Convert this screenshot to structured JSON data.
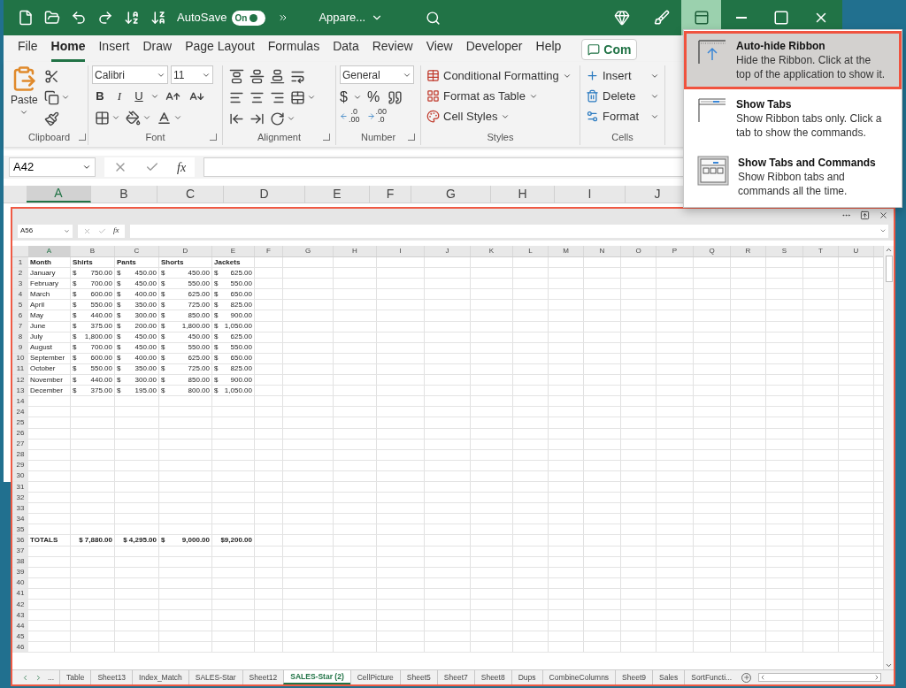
{
  "window": {
    "title": "Appare...",
    "autosave": {
      "label": "AutoSave",
      "toggle": "On",
      "on": true
    }
  },
  "caption_buttons": [
    {
      "kind": "premium",
      "selected": false
    },
    {
      "kind": "draw",
      "selected": false
    },
    {
      "kind": "ribbon-options",
      "selected": true
    },
    {
      "kind": "minimize",
      "selected": false
    },
    {
      "kind": "maximize",
      "selected": false
    },
    {
      "kind": "close",
      "selected": false
    }
  ],
  "ribbon_tabs": [
    {
      "label": "File",
      "selected": false
    },
    {
      "label": "Home",
      "selected": true
    },
    {
      "label": "Insert",
      "selected": false
    },
    {
      "label": "Draw",
      "selected": false
    },
    {
      "label": "Page Layout",
      "selected": false
    },
    {
      "label": "Formulas",
      "selected": false
    },
    {
      "label": "Data",
      "selected": false
    },
    {
      "label": "Review",
      "selected": false
    },
    {
      "label": "View",
      "selected": false
    },
    {
      "label": "Developer",
      "selected": false
    },
    {
      "label": "Help",
      "selected": false
    }
  ],
  "comments_button": {
    "label": "Com"
  },
  "ribbon": {
    "clipboard": {
      "paste": "Paste",
      "label": "Clipboard"
    },
    "font": {
      "name": "Calibri",
      "size": "11",
      "bold": "B",
      "italic": "I",
      "underline": "U",
      "label": "Font"
    },
    "alignment": {
      "label": "Alignment"
    },
    "number": {
      "format": "General",
      "currency": "$",
      "percent": "%",
      "decimal_increase": [
        ".0",
        ".00"
      ],
      "decimal_decrease": [
        ".00",
        ".0"
      ],
      "label": "Number"
    },
    "styles": {
      "items": [
        "Conditional Formatting",
        "Format as Table",
        "Cell Styles"
      ],
      "label": "Styles"
    },
    "cells": {
      "items": [
        "Insert",
        "Delete",
        "Format"
      ],
      "label": "Cells"
    }
  },
  "formula_bar": {
    "name_box": "A42",
    "fx": "fx"
  },
  "columns": [
    {
      "label": "A",
      "selected": true
    },
    {
      "label": "B",
      "selected": false
    },
    {
      "label": "C",
      "selected": false
    },
    {
      "label": "D",
      "selected": false
    },
    {
      "label": "E",
      "selected": false
    },
    {
      "label": "F",
      "selected": false
    },
    {
      "label": "G",
      "selected": false
    },
    {
      "label": "H",
      "selected": false
    },
    {
      "label": "I",
      "selected": false
    },
    {
      "label": "J",
      "selected": false
    }
  ],
  "inset": {
    "name_box": "A56",
    "fx": "fx",
    "columns": [
      {
        "label": "A",
        "selected": true
      },
      {
        "label": "B",
        "selected": false
      },
      {
        "label": "C",
        "selected": false
      },
      {
        "label": "D",
        "selected": false
      },
      {
        "label": "E",
        "selected": false
      },
      {
        "label": "F",
        "selected": false
      },
      {
        "label": "G",
        "selected": false
      },
      {
        "label": "H",
        "selected": false
      },
      {
        "label": "I",
        "selected": false
      },
      {
        "label": "J",
        "selected": false
      },
      {
        "label": "K",
        "selected": false
      },
      {
        "label": "L",
        "selected": false
      },
      {
        "label": "M",
        "selected": false
      },
      {
        "label": "N",
        "selected": false
      },
      {
        "label": "O",
        "selected": false
      },
      {
        "label": "P",
        "selected": false
      },
      {
        "label": "Q",
        "selected": false
      },
      {
        "label": "R",
        "selected": false
      },
      {
        "label": "S",
        "selected": false
      },
      {
        "label": "T",
        "selected": false
      },
      {
        "label": "U",
        "selected": false
      }
    ],
    "rows": [
      {
        "header": "1",
        "bold": true,
        "cells": [
          "Month",
          "Shirts",
          "Pants",
          "Shorts",
          "Jackets"
        ]
      },
      {
        "header": "2",
        "bold": false,
        "cells": [
          "January",
          [
            "$",
            "750.00"
          ],
          [
            "$",
            "450.00"
          ],
          [
            "$",
            "450.00"
          ],
          [
            "$",
            "625.00"
          ]
        ]
      },
      {
        "header": "3",
        "bold": false,
        "cells": [
          "February",
          [
            "$",
            "700.00"
          ],
          [
            "$",
            "450.00"
          ],
          [
            "$",
            "550.00"
          ],
          [
            "$",
            "550.00"
          ]
        ]
      },
      {
        "header": "4",
        "bold": false,
        "cells": [
          "March",
          [
            "$",
            "600.00"
          ],
          [
            "$",
            "400.00"
          ],
          [
            "$",
            "625.00"
          ],
          [
            "$",
            "650.00"
          ]
        ]
      },
      {
        "header": "5",
        "bold": false,
        "cells": [
          "April",
          [
            "$",
            "550.00"
          ],
          [
            "$",
            "350.00"
          ],
          [
            "$",
            "725.00"
          ],
          [
            "$",
            "825.00"
          ]
        ]
      },
      {
        "header": "6",
        "bold": false,
        "cells": [
          "May",
          [
            "$",
            "440.00"
          ],
          [
            "$",
            "300.00"
          ],
          [
            "$",
            "850.00"
          ],
          [
            "$",
            "900.00"
          ]
        ]
      },
      {
        "header": "7",
        "bold": false,
        "cells": [
          "June",
          [
            "$",
            "375.00"
          ],
          [
            "$",
            "200.00"
          ],
          [
            "$",
            "1,800.00"
          ],
          [
            "$",
            "1,050.00"
          ]
        ]
      },
      {
        "header": "8",
        "bold": false,
        "cells": [
          "July",
          [
            "$",
            "1,800.00"
          ],
          [
            "$",
            "450.00"
          ],
          [
            "$",
            "450.00"
          ],
          [
            "$",
            "625.00"
          ]
        ]
      },
      {
        "header": "9",
        "bold": false,
        "cells": [
          "August",
          [
            "$",
            "700.00"
          ],
          [
            "$",
            "450.00"
          ],
          [
            "$",
            "550.00"
          ],
          [
            "$",
            "550.00"
          ]
        ]
      },
      {
        "header": "10",
        "bold": false,
        "cells": [
          "September",
          [
            "$",
            "600.00"
          ],
          [
            "$",
            "400.00"
          ],
          [
            "$",
            "625.00"
          ],
          [
            "$",
            "650.00"
          ]
        ]
      },
      {
        "header": "11",
        "bold": false,
        "cells": [
          "October",
          [
            "$",
            "550.00"
          ],
          [
            "$",
            "350.00"
          ],
          [
            "$",
            "725.00"
          ],
          [
            "$",
            "825.00"
          ]
        ]
      },
      {
        "header": "12",
        "bold": false,
        "cells": [
          "November",
          [
            "$",
            "440.00"
          ],
          [
            "$",
            "300.00"
          ],
          [
            "$",
            "850.00"
          ],
          [
            "$",
            "900.00"
          ]
        ]
      },
      {
        "header": "13",
        "bold": false,
        "cells": [
          "December",
          [
            "$",
            "375.00"
          ],
          [
            "$",
            "195.00"
          ],
          [
            "$",
            "800.00"
          ],
          [
            "$",
            "1,050.00"
          ]
        ]
      },
      {
        "header": "14"
      },
      {
        "header": "24"
      },
      {
        "header": "25"
      },
      {
        "header": "26"
      },
      {
        "header": "27"
      },
      {
        "header": "28"
      },
      {
        "header": "29"
      },
      {
        "header": "30"
      },
      {
        "header": "31"
      },
      {
        "header": "32"
      },
      {
        "header": "33"
      },
      {
        "header": "34"
      },
      {
        "header": "35"
      },
      {
        "header": "36",
        "bold": true,
        "cells": [
          "TOTALS",
          [
            "$ 7,880.00"
          ],
          [
            "$ 4,295.00"
          ],
          [
            "$",
            "9,000.00"
          ],
          [
            "$9,200.00"
          ]
        ]
      },
      {
        "header": "37"
      },
      {
        "header": "38"
      },
      {
        "header": "39"
      },
      {
        "header": "40"
      },
      {
        "header": "41"
      },
      {
        "header": "42"
      },
      {
        "header": "43"
      },
      {
        "header": "44"
      },
      {
        "header": "45"
      },
      {
        "header": "46"
      }
    ],
    "more_tabs": "...",
    "sheet_tabs": [
      {
        "label": "Table",
        "selected": false
      },
      {
        "label": "Sheet13",
        "selected": false
      },
      {
        "label": "Index_Match",
        "selected": false
      },
      {
        "label": "SALES-Star",
        "selected": false
      },
      {
        "label": "Sheet12",
        "selected": false
      },
      {
        "label": "SALES-Star (2)",
        "selected": true
      },
      {
        "label": "CellPicture",
        "selected": false
      },
      {
        "label": "Sheet5",
        "selected": false
      },
      {
        "label": "Sheet7",
        "selected": false
      },
      {
        "label": "Sheet8",
        "selected": false
      },
      {
        "label": "Dups",
        "selected": false
      },
      {
        "label": "CombineColumns",
        "selected": false
      },
      {
        "label": "Sheet9",
        "selected": false
      },
      {
        "label": "Sales",
        "selected": false
      },
      {
        "label": "SortFuncti...",
        "selected": false
      }
    ]
  },
  "menu": {
    "items": [
      {
        "kind": "auto-hide",
        "title": "Auto-hide Ribbon",
        "description": "Hide the Ribbon. Click at the top of the application to show it.",
        "selected": true
      },
      {
        "kind": "tabs",
        "title": "Show Tabs",
        "description": "Show Ribbon tabs only. Click a tab to show the commands.",
        "selected": false
      },
      {
        "kind": "tabs-commands",
        "title": "Show Tabs and Commands",
        "description": "Show Ribbon tabs and commands all the time.",
        "selected": false
      }
    ]
  }
}
